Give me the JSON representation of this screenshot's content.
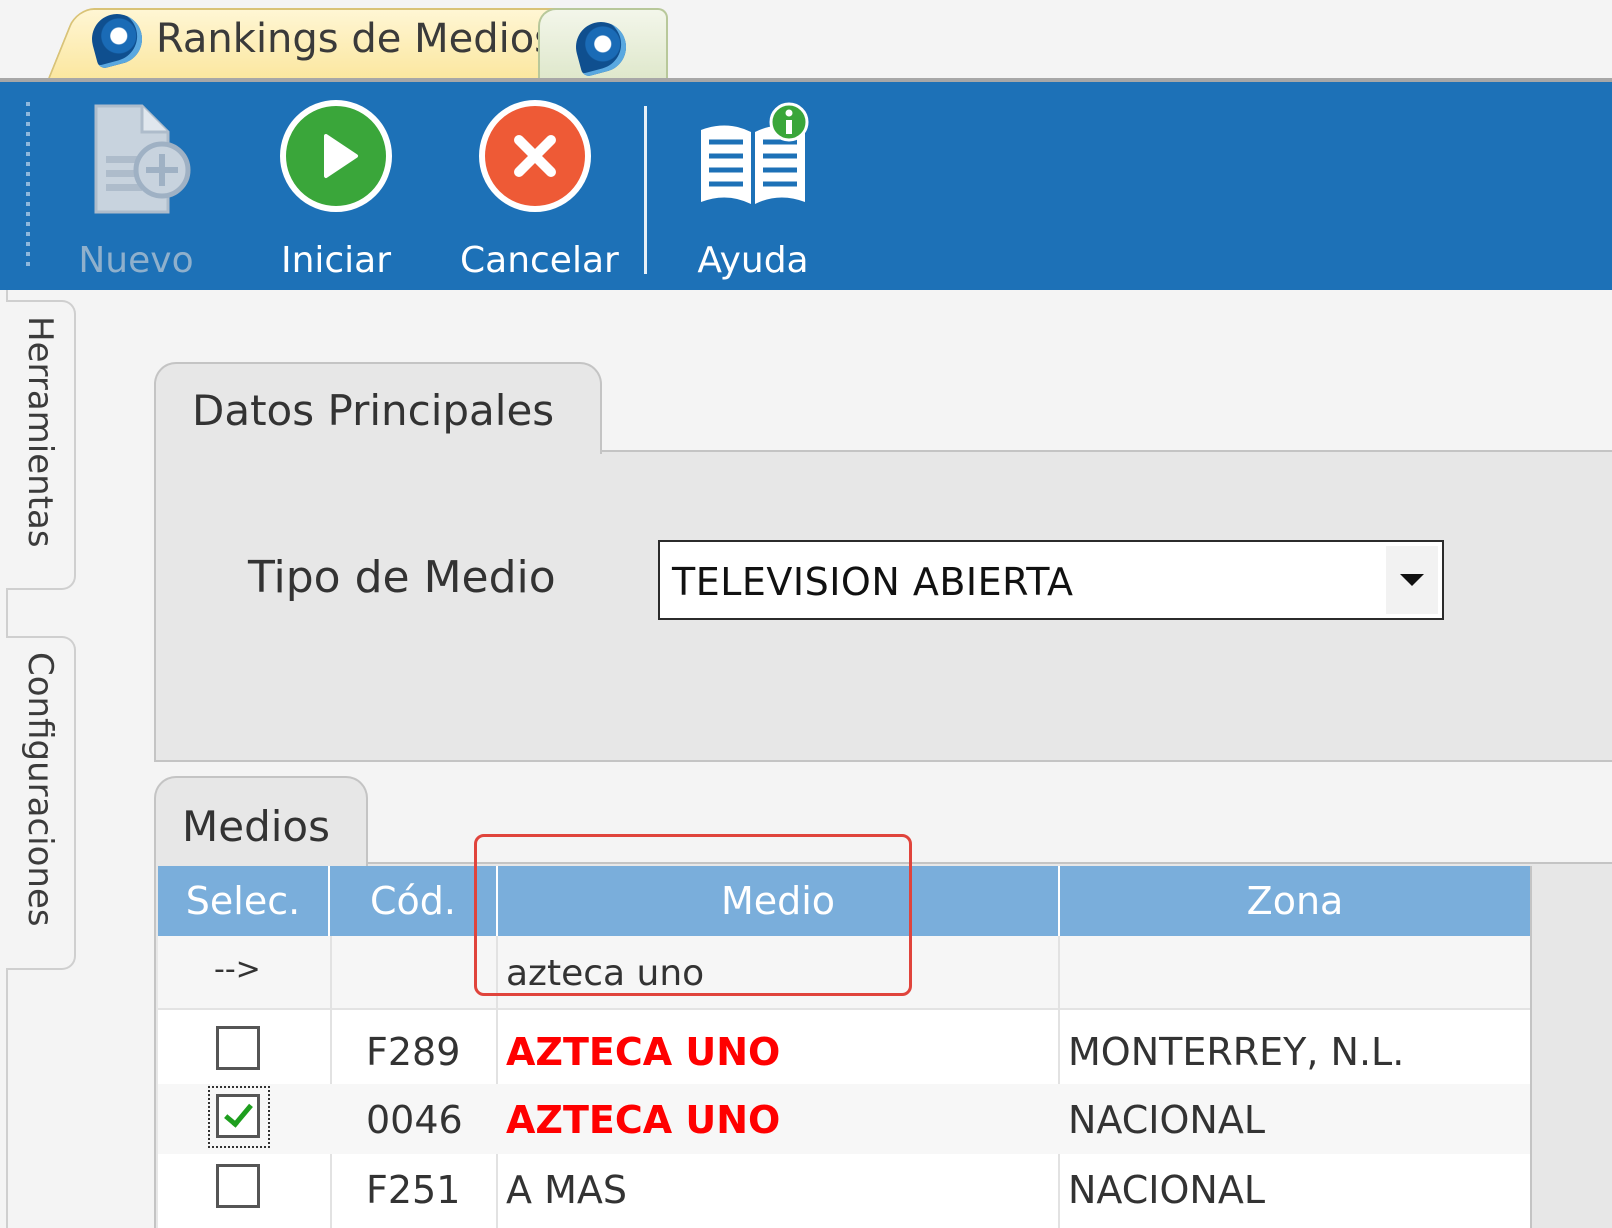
{
  "doc_tabs": [
    {
      "title": "Rankings de Medios",
      "icon": "app-logo-icon"
    },
    {
      "title": "",
      "icon": "app-logo-icon"
    }
  ],
  "toolbar": {
    "nuevo": {
      "label": "Nuevo",
      "icon": "new-document-icon",
      "enabled": false
    },
    "iniciar": {
      "label": "Iniciar",
      "icon": "play-icon",
      "enabled": true
    },
    "cancelar": {
      "label": "Cancelar",
      "icon": "cancel-icon",
      "enabled": true
    },
    "ayuda": {
      "label": "Ayuda",
      "icon": "help-book-icon",
      "enabled": true
    }
  },
  "side_tabs": [
    "Herramientas",
    "Configuraciones"
  ],
  "datos_principales": {
    "title": "Datos Principales",
    "tipo_label": "Tipo de Medio",
    "tipo_value": "TELEVISION ABIERTA"
  },
  "medios": {
    "title": "Medios",
    "columns": [
      "Selec.",
      "Cód.",
      "Medio",
      "Zona"
    ],
    "filter_row": {
      "marker": "-->",
      "medio_filter": "azteca uno"
    },
    "rows": [
      {
        "selected": false,
        "code": "F289",
        "medio": "AZTECA UNO",
        "zona": "MONTERREY, N.L.",
        "highlight": true
      },
      {
        "selected": true,
        "code": "0046",
        "medio": "AZTECA UNO",
        "zona": "NACIONAL",
        "highlight": true
      },
      {
        "selected": false,
        "code": "F251",
        "medio": "A MAS",
        "zona": "NACIONAL",
        "highlight": false
      }
    ]
  },
  "colors": {
    "ribbon": "#1d71b7",
    "grid_header": "#7aaedb",
    "match_text": "#ff0000",
    "annotation": "#e0443c"
  }
}
